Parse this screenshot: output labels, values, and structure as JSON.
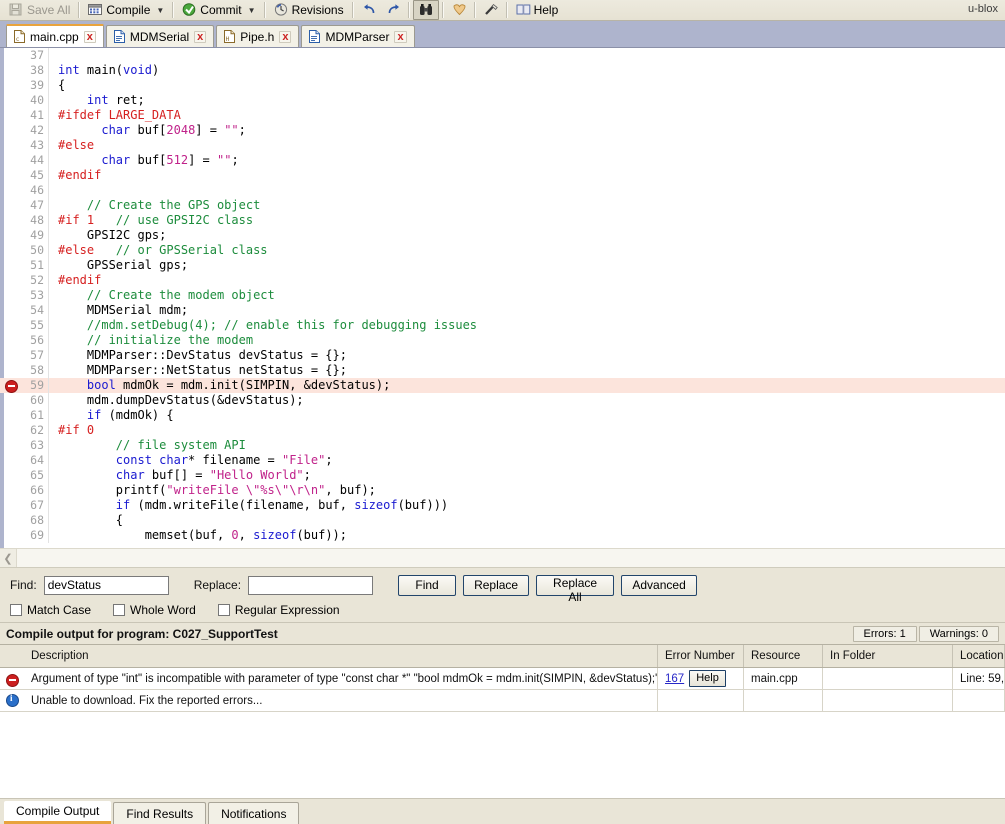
{
  "toolbar": {
    "save_all": "Save All",
    "compile": "Compile",
    "commit": "Commit",
    "revisions": "Revisions",
    "help": "Help",
    "brand": "u-blox",
    "icons": {
      "compile": "compile-icon",
      "commit": "commit-icon",
      "revisions": "revisions-icon",
      "undo": "undo-icon",
      "redo": "redo-icon",
      "find": "binoculars-find-icon",
      "bookmark": "bookmark-icon",
      "wand": "magic-wand-icon",
      "help": "book-help-icon"
    }
  },
  "file_tabs": [
    {
      "label": "main.cpp",
      "type": "cpp",
      "close": "x",
      "active": true
    },
    {
      "label": "MDMSerial",
      "type": "cpp",
      "close": "x",
      "active": false
    },
    {
      "label": "Pipe.h",
      "type": "h",
      "close": "x",
      "active": false
    },
    {
      "label": "MDMParser",
      "type": "cpp",
      "close": "x",
      "active": false
    }
  ],
  "editor": {
    "lines": [
      {
        "n": 37,
        "marker": "",
        "error": false,
        "tokens": []
      },
      {
        "n": 38,
        "marker": "",
        "error": false,
        "tokens": [
          {
            "t": "k",
            "s": "int"
          },
          {
            "t": "",
            "s": " main("
          },
          {
            "t": "k",
            "s": "void"
          },
          {
            "t": "",
            "s": ")"
          }
        ]
      },
      {
        "n": 39,
        "marker": "",
        "error": false,
        "tokens": [
          {
            "t": "",
            "s": "{"
          }
        ]
      },
      {
        "n": 40,
        "marker": "",
        "error": false,
        "tokens": [
          {
            "t": "",
            "s": "    "
          },
          {
            "t": "k",
            "s": "int"
          },
          {
            "t": "",
            "s": " ret;"
          }
        ]
      },
      {
        "n": 41,
        "marker": "",
        "error": false,
        "tokens": [
          {
            "t": "pp",
            "s": "#ifdef LARGE_DATA"
          }
        ]
      },
      {
        "n": 42,
        "marker": "",
        "error": false,
        "tokens": [
          {
            "t": "",
            "s": "      "
          },
          {
            "t": "k",
            "s": "char"
          },
          {
            "t": "",
            "s": " buf["
          },
          {
            "t": "nm",
            "s": "2048"
          },
          {
            "t": "",
            "s": "] = "
          },
          {
            "t": "st",
            "s": "\"\""
          },
          {
            "t": "",
            "s": ";"
          }
        ]
      },
      {
        "n": 43,
        "marker": "",
        "error": false,
        "tokens": [
          {
            "t": "pp",
            "s": "#else"
          }
        ]
      },
      {
        "n": 44,
        "marker": "",
        "error": false,
        "tokens": [
          {
            "t": "",
            "s": "      "
          },
          {
            "t": "k",
            "s": "char"
          },
          {
            "t": "",
            "s": " buf["
          },
          {
            "t": "nm",
            "s": "512"
          },
          {
            "t": "",
            "s": "] = "
          },
          {
            "t": "st",
            "s": "\"\""
          },
          {
            "t": "",
            "s": ";"
          }
        ]
      },
      {
        "n": 45,
        "marker": "",
        "error": false,
        "tokens": [
          {
            "t": "pp",
            "s": "#endif"
          }
        ]
      },
      {
        "n": 46,
        "marker": "",
        "error": false,
        "tokens": []
      },
      {
        "n": 47,
        "marker": "",
        "error": false,
        "tokens": [
          {
            "t": "",
            "s": "    "
          },
          {
            "t": "cm",
            "s": "// Create the GPS object"
          }
        ]
      },
      {
        "n": 48,
        "marker": "",
        "error": false,
        "tokens": [
          {
            "t": "pp",
            "s": "#if 1"
          },
          {
            "t": "",
            "s": "   "
          },
          {
            "t": "cm",
            "s": "// use GPSI2C class"
          }
        ]
      },
      {
        "n": 49,
        "marker": "",
        "error": false,
        "tokens": [
          {
            "t": "",
            "s": "    GPSI2C gps;"
          }
        ]
      },
      {
        "n": 50,
        "marker": "",
        "error": false,
        "tokens": [
          {
            "t": "pp",
            "s": "#else"
          },
          {
            "t": "",
            "s": "   "
          },
          {
            "t": "cm",
            "s": "// or GPSSerial class"
          }
        ]
      },
      {
        "n": 51,
        "marker": "",
        "error": false,
        "tokens": [
          {
            "t": "",
            "s": "    GPSSerial gps;"
          }
        ]
      },
      {
        "n": 52,
        "marker": "",
        "error": false,
        "tokens": [
          {
            "t": "pp",
            "s": "#endif"
          }
        ]
      },
      {
        "n": 53,
        "marker": "",
        "error": false,
        "tokens": [
          {
            "t": "",
            "s": "    "
          },
          {
            "t": "cm",
            "s": "// Create the modem object"
          }
        ]
      },
      {
        "n": 54,
        "marker": "",
        "error": false,
        "tokens": [
          {
            "t": "",
            "s": "    MDMSerial mdm;"
          }
        ]
      },
      {
        "n": 55,
        "marker": "",
        "error": false,
        "tokens": [
          {
            "t": "",
            "s": "    "
          },
          {
            "t": "cm",
            "s": "//mdm.setDebug(4); // enable this for debugging issues"
          }
        ]
      },
      {
        "n": 56,
        "marker": "",
        "error": false,
        "tokens": [
          {
            "t": "",
            "s": "    "
          },
          {
            "t": "cm",
            "s": "// initialize the modem"
          }
        ]
      },
      {
        "n": 57,
        "marker": "",
        "error": false,
        "tokens": [
          {
            "t": "",
            "s": "    MDMParser::DevStatus devStatus = {};"
          }
        ]
      },
      {
        "n": 58,
        "marker": "",
        "error": false,
        "tokens": [
          {
            "t": "",
            "s": "    MDMParser::NetStatus netStatus = {};"
          }
        ]
      },
      {
        "n": 59,
        "marker": "error",
        "error": true,
        "tokens": [
          {
            "t": "",
            "s": "    "
          },
          {
            "t": "k",
            "s": "bool"
          },
          {
            "t": "",
            "s": " mdmOk = mdm.init(SIMPIN, &devStatus);"
          }
        ]
      },
      {
        "n": 60,
        "marker": "",
        "error": false,
        "tokens": [
          {
            "t": "",
            "s": "    mdm.dumpDevStatus(&devStatus);"
          }
        ]
      },
      {
        "n": 61,
        "marker": "",
        "error": false,
        "tokens": [
          {
            "t": "",
            "s": "    "
          },
          {
            "t": "k",
            "s": "if"
          },
          {
            "t": "",
            "s": " (mdmOk) {"
          }
        ]
      },
      {
        "n": 62,
        "marker": "",
        "error": false,
        "tokens": [
          {
            "t": "pp",
            "s": "#if 0"
          }
        ]
      },
      {
        "n": 63,
        "marker": "",
        "error": false,
        "tokens": [
          {
            "t": "",
            "s": "        "
          },
          {
            "t": "cm",
            "s": "// file system API"
          }
        ]
      },
      {
        "n": 64,
        "marker": "",
        "error": false,
        "tokens": [
          {
            "t": "",
            "s": "        "
          },
          {
            "t": "k",
            "s": "const char"
          },
          {
            "t": "",
            "s": "* filename = "
          },
          {
            "t": "st",
            "s": "\"File\""
          },
          {
            "t": "",
            "s": ";"
          }
        ]
      },
      {
        "n": 65,
        "marker": "",
        "error": false,
        "tokens": [
          {
            "t": "",
            "s": "        "
          },
          {
            "t": "k",
            "s": "char"
          },
          {
            "t": "",
            "s": " buf[] = "
          },
          {
            "t": "st",
            "s": "\"Hello World\""
          },
          {
            "t": "",
            "s": ";"
          }
        ]
      },
      {
        "n": 66,
        "marker": "",
        "error": false,
        "tokens": [
          {
            "t": "",
            "s": "        printf("
          },
          {
            "t": "st",
            "s": "\"writeFile \\\"%s\\\"\\r\\n\""
          },
          {
            "t": "",
            "s": ", buf);"
          }
        ]
      },
      {
        "n": 67,
        "marker": "",
        "error": false,
        "tokens": [
          {
            "t": "",
            "s": "        "
          },
          {
            "t": "k",
            "s": "if"
          },
          {
            "t": "",
            "s": " (mdm.writeFile(filename, buf, "
          },
          {
            "t": "k",
            "s": "sizeof"
          },
          {
            "t": "",
            "s": "(buf)))"
          }
        ]
      },
      {
        "n": 68,
        "marker": "",
        "error": false,
        "tokens": [
          {
            "t": "",
            "s": "        {"
          }
        ]
      },
      {
        "n": 69,
        "marker": "",
        "error": false,
        "tokens": [
          {
            "t": "",
            "s": "            memset(buf, "
          },
          {
            "t": "nm",
            "s": "0"
          },
          {
            "t": "",
            "s": ", "
          },
          {
            "t": "k",
            "s": "sizeof"
          },
          {
            "t": "",
            "s": "(buf));"
          }
        ]
      }
    ]
  },
  "find_bar": {
    "find_label": "Find:",
    "find_value": "devStatus",
    "find_placeholder": "",
    "replace_label": "Replace:",
    "replace_value": "",
    "replace_placeholder": "",
    "buttons": [
      "Find",
      "Replace",
      "Replace All",
      "Advanced"
    ],
    "checkboxes": [
      {
        "label": "Match Case",
        "checked": false
      },
      {
        "label": "Whole Word",
        "checked": false
      },
      {
        "label": "Regular Expression",
        "checked": false
      }
    ]
  },
  "compile_output": {
    "title": "Compile output for program: C027_SupportTest",
    "errors_chip": "Errors: 1",
    "warnings_chip": "Warnings: 0",
    "columns": [
      "Description",
      "Error Number",
      "Resource",
      "In Folder",
      "Location"
    ],
    "rows": [
      {
        "icon": "error-icon",
        "description": "Argument of type \"int\" is incompatible with parameter of type \"const char *\" \"bool mdmOk = mdm.init(SIMPIN, &devStatus);\"",
        "error_number": "167",
        "help_label": "Help",
        "resource": "main.cpp",
        "in_folder": "",
        "location": "Line: 59, "
      },
      {
        "icon": "info-icon",
        "description": "Unable to download. Fix the reported errors...",
        "error_number": "",
        "help_label": "",
        "resource": "",
        "in_folder": "",
        "location": ""
      }
    ]
  },
  "bottom_tabs": [
    {
      "label": "Compile Output",
      "active": true
    },
    {
      "label": "Find Results",
      "active": false
    },
    {
      "label": "Notifications",
      "active": false
    }
  ],
  "colors": {
    "accent": "#e8a33d",
    "tabstrip": "#aeb4cd",
    "chrome": "#e9e5d7",
    "error_line": "#fce4dc",
    "error_red": "#cc1f1f",
    "link_blue": "#2727c8"
  }
}
